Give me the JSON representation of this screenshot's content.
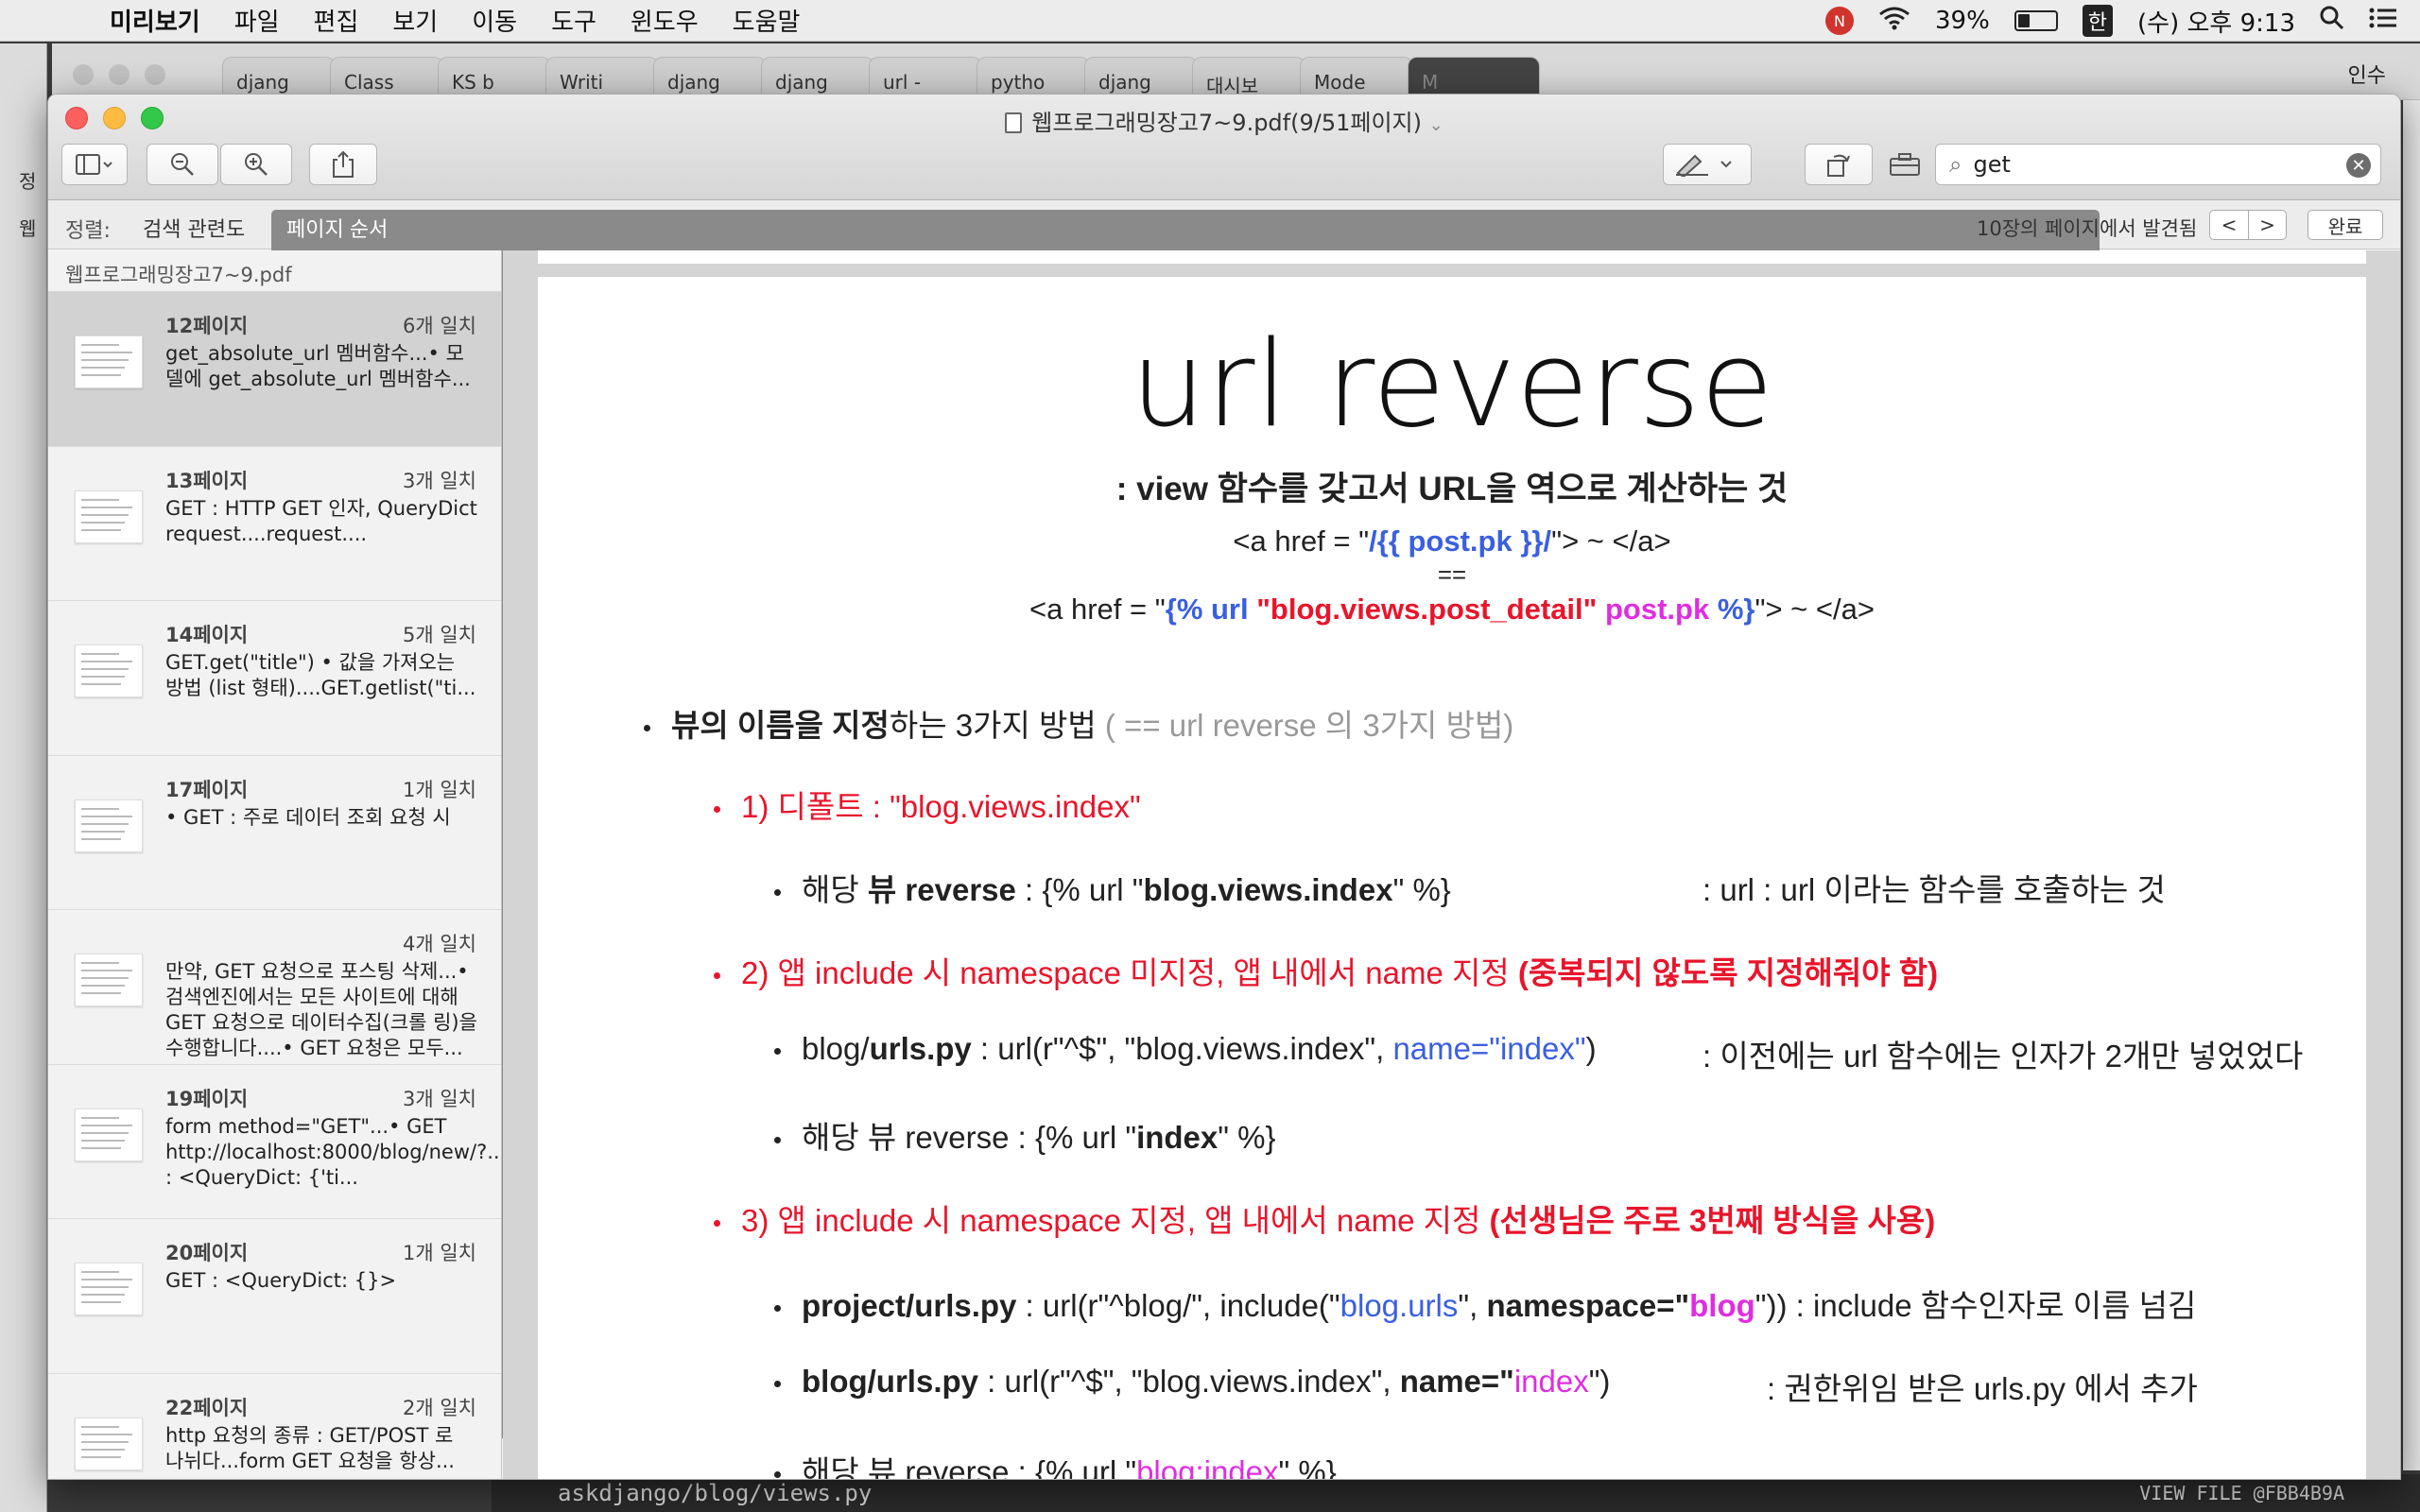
{
  "menubar": {
    "app": "미리보기",
    "items": [
      "파일",
      "편집",
      "보기",
      "이동",
      "도구",
      "윈도우",
      "도움말"
    ],
    "battery_pct": "39%",
    "battery_level": 0.39,
    "input_method": "한",
    "clock": "(수) 오후 9:13"
  },
  "browser": {
    "tabs": [
      "djang",
      "Class",
      "KS b",
      "Writi",
      "djang",
      "djang",
      "url -",
      "pytho",
      "djang",
      "대시보",
      "Mode",
      "M"
    ],
    "print_label": "인수"
  },
  "left_strip": [
    "정",
    "웹"
  ],
  "bottom_strip": {
    "file": "askdjango/blog/views.py",
    "view_file": "VIEW FILE @FBB4B9A"
  },
  "window": {
    "title": "웹프로그래밍장고7~9.pdf(9/51페이지)",
    "search_value": "get"
  },
  "sortbar": {
    "label": "정렬:",
    "relevance": "검색 관련도",
    "page_order": "페이지 순서",
    "found": "10장의 페이지에서 발견됨",
    "prev": "<",
    "next": ">",
    "done": "완료"
  },
  "sidebar": {
    "filename": "웹프로그래밍장고7~9.pdf",
    "results": [
      {
        "page": "12페이지",
        "count": "6개 일치",
        "snippet": "get_absolute_url 멤버함수...• 모델에 get_absolute_url 멤버함수..."
      },
      {
        "page": "13페이지",
        "count": "3개 일치",
        "snippet": "GET : HTTP GET 인자, QueryDict request....request...."
      },
      {
        "page": "14페이지",
        "count": "5개 일치",
        "snippet": "GET.get(\"title\") • 값을 가져오는 방법 (list 형태)....GET.getlist(\"ti..."
      },
      {
        "page": "17페이지",
        "count": "1개 일치",
        "snippet": "• GET : 주로 데이터 조회 요청 시"
      },
      {
        "page": "",
        "count": "4개 일치",
        "snippet": "만약, GET 요청으로 포스팅 삭제...• 검색엔진에서는 모든 사이트에 대해 GET 요청으로 데이터수집(크롤 링)을 수행합니다....• GET 요청은 모두..."
      },
      {
        "page": "19페이지",
        "count": "3개 일치",
        "snippet": "form method=\"GET\"...• GET http://localhost:8000/blog/new/?...GET : <QueryDict: {'ti..."
      },
      {
        "page": "20페이지",
        "count": "1개 일치",
        "snippet": "GET : <QueryDict: {}>"
      },
      {
        "page": "22페이지",
        "count": "2개 일치",
        "snippet": "http 요청의 종류 : GET/POST 로 나뉘다...form GET 요청을 항상..."
      }
    ]
  },
  "slide": {
    "title": "url reverse",
    "subtitle": ": view 함수를 갖고서 URL을 역으로 계산하는 것",
    "code1_a": "<a href = \"",
    "code1_b": "/{{ post.pk }}/",
    "code1_c": "\"> ~ </a>",
    "eq": "==",
    "code2_a": "<a href = \"",
    "code2_b": "{% url ",
    "code2_c": "\"blog.views.post_detail\"",
    "code2_d": " post.pk ",
    "code2_e": "%}",
    "code2_f": "\"> ~ </a>",
    "bullet1_bold": "뷰의 이름을 지정",
    "bullet1_rest": "하는 3가지 방법 ",
    "bullet1_gray": "( == url reverse 의 3가지 방법)",
    "m1": "1) 디폴트 : \"blog.views.index\"",
    "m1_a_pre": "해당 ",
    "m1_a_b1": "뷰 reverse",
    "m1_a_mid": " : {% url \"",
    "m1_a_b2": "blog.views.index",
    "m1_a_end": "\" %}",
    "m1_note": ": url : url 이라는 함수를 호출하는 것",
    "m2": "2) 앱 include 시 namespace 미지정, 앱 내에서 name 지정 ",
    "m2_bold": "(중복되지 않도록 지정해줘야 함)",
    "m2_a_pre": "blog/",
    "m2_a_b": "urls.py",
    "m2_a_mid": " : url(r\"^$\", \"blog.views.index\", ",
    "m2_a_blue": "name=\"index\"",
    "m2_a_end": ")",
    "m2_note": ": 이전에는 url 함수에는 인자가 2개만 넣었었다",
    "m2_b_pre": "해당 뷰 reverse : {% url \"",
    "m2_b_b": "index",
    "m2_b_end": "\" %}",
    "m3": "3) 앱 include 시 namespace 지정, 앱 내에서 name 지정 ",
    "m3_bold": "(선생님은 주로 3번째 방식을 사용)",
    "m3_a_b": "project/urls.py",
    "m3_a_mid": " : url(r\"^blog/\", include(\"",
    "m3_a_blue": "blog.urls",
    "m3_a_mid2": "\", ",
    "m3_a_b2": "namespace=\"",
    "m3_a_mag": "blog",
    "m3_a_end": "\"))",
    "m3_a_note": " : include 함수인자로 이름 넘김",
    "m3_b_b": "blog/urls.py",
    "m3_b_mid": " : url(r\"^$\", \"blog.views.index\", ",
    "m3_b_b2": "name=\"",
    "m3_b_mag": "index",
    "m3_b_end": "\")",
    "m3_b_note": ": 권한위임 받은 urls.py 에서 추가",
    "m3_c_pre": "해당 뷰 reverse : {% url \"",
    "m3_c_mag": "blog:index",
    "m3_c_end": "\" %}"
  }
}
